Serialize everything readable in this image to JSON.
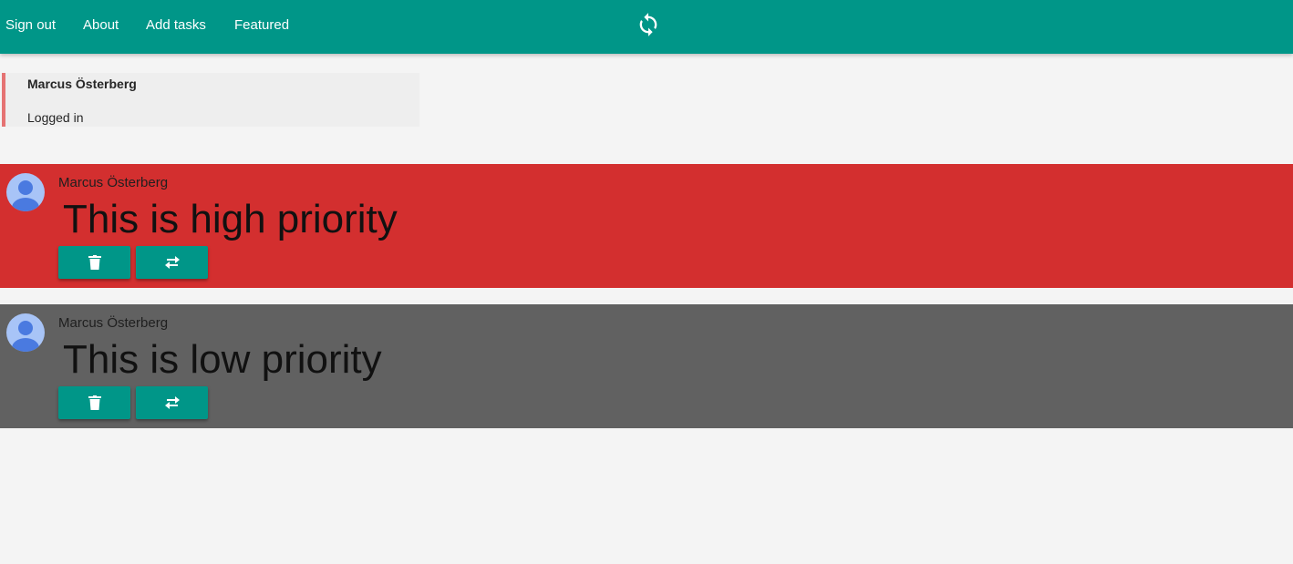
{
  "nav": {
    "links": [
      "Sign out",
      "About",
      "Add tasks",
      "Featured"
    ],
    "refresh_icon": "refresh-icon",
    "background": "#009688"
  },
  "user_card": {
    "name": "Marcus Österberg",
    "status": "Logged in",
    "accent": "#e57373"
  },
  "tasks": [
    {
      "author": "Marcus Österberg",
      "title": "This is high priority",
      "background": "#d32f2f",
      "avatar_icon": "avatar-icon",
      "actions": [
        "delete-icon",
        "swap-priority-icon"
      ]
    },
    {
      "author": "Marcus Österberg",
      "title": "This is low priority",
      "background": "#616161",
      "avatar_icon": "avatar-icon",
      "actions": [
        "delete-icon",
        "swap-priority-icon"
      ]
    }
  ],
  "colors": {
    "button": "#009688",
    "page_background": "#f4f4f4"
  }
}
